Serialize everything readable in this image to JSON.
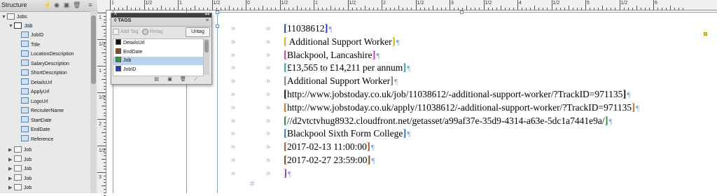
{
  "structure": {
    "title": "Structure",
    "root": "Jobs",
    "job_open": "Job",
    "children": [
      "JobID",
      "Title",
      "LocationDescription",
      "SalaryDescription",
      "ShortDescription",
      "DetailsUrl",
      "ApplyUrl",
      "LogoUrl",
      "RecruiterName",
      "StartDate",
      "EndDate",
      "Reference"
    ],
    "collapsed_jobs": [
      "Job",
      "Job",
      "Job",
      "Job",
      "Job",
      "Job"
    ]
  },
  "ruler": {
    "h_labels": [
      "1",
      "1/2",
      "1",
      "1/2",
      "0",
      "1/2",
      "1",
      "1/2",
      "2",
      "1/2",
      "3",
      "1/2",
      "4",
      "1/2",
      "5",
      "1/2",
      "6"
    ],
    "v_labels": [
      "1",
      "1/2",
      "1",
      "1/2",
      "2",
      "1/2",
      "3"
    ]
  },
  "tags_panel": {
    "title": "◊ TAGS",
    "add_tag": "Add Tag",
    "retag": "Retag",
    "untag": "Untag",
    "items": [
      {
        "name": "DetailsUrl",
        "color": "#111111"
      },
      {
        "name": "EndDate",
        "color": "#8a4a1a"
      },
      {
        "name": "Job",
        "color": "#2a9a3a"
      },
      {
        "name": "JobID",
        "color": "#2a3ab0"
      }
    ],
    "selected": "Job"
  },
  "document": {
    "lines": [
      {
        "text": "11038612",
        "bracket_color": "#2a3ab0"
      },
      {
        "text": " Additional Support Worker",
        "bracket_color": "#d7b000"
      },
      {
        "text": "Blackpool, Lancashire",
        "bracket_color": "#c43ab0"
      },
      {
        "text": "£13,565 to £14,211 per annum",
        "bracket_color": "#2aa0a0"
      },
      {
        "text": "Additional Support Worker",
        "bracket_color": "#7a7a7a"
      },
      {
        "text": "http://www.jobstoday.co.uk/job/11038612/-additional-support-worker/?TrackID=971135",
        "bracket_color": "#111111"
      },
      {
        "text": "http://www.jobstoday.co.uk/apply/11038612/-additional-support-worker/?TrackID=971135",
        "bracket_color": "#d46a1a"
      },
      {
        "text": "//d2vtctvhug8932.cloudfront.net/getasset/a99af37e-35d9-4314-a63e-5dc1a7441e9a/",
        "bracket_color": "#2a8a3a"
      },
      {
        "text": "Blackpool Sixth Form College",
        "bracket_color": "#2a7ab0"
      },
      {
        "text": "2017-02-13 11:00:00",
        "bracket_color": "#b0502a"
      },
      {
        "text": "2017-02-27 23:59:00",
        "bracket_color": "#8a3a1a"
      }
    ],
    "pilcrow": "¶",
    "arrow": "»",
    "hash": "#"
  },
  "colors": {
    "accent": "#7aa6d6",
    "selection": "#b9d3ee",
    "frame_handle": "#f3d100"
  }
}
